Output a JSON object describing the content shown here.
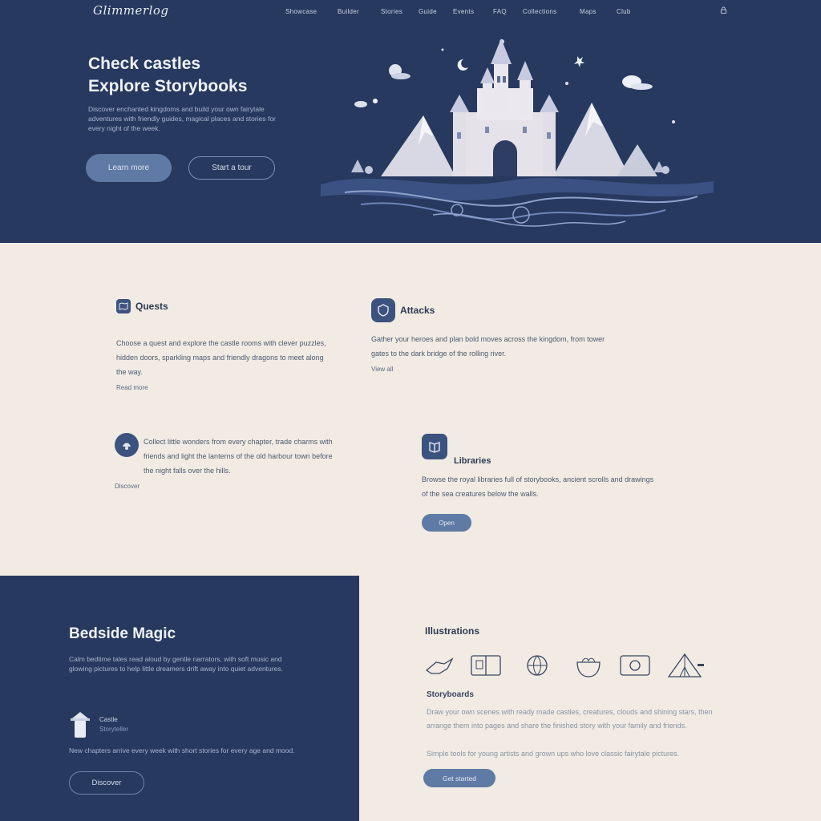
{
  "brand": {
    "logo_text": "Glimmerlog"
  },
  "nav": {
    "items": [
      "Showcase",
      "Builder",
      "Stories",
      "Guide",
      "Events",
      "FAQ",
      "Collections",
      "Maps",
      "Club"
    ]
  },
  "hero": {
    "title_line1": "Check castles",
    "title_line2": "Explore Storybooks",
    "text": "Discover enchanted kingdoms and build your own fairytale adventures with friendly guides, magical places and stories for every night of the week.",
    "primary_button": "Learn more",
    "secondary_button": "Start a tour"
  },
  "features": {
    "items": [
      {
        "title": "Quests",
        "text": "Choose a quest and explore the castle rooms with clever puzzles, hidden doors, sparkling maps and friendly dragons to meet along the way.",
        "link": "Read more"
      },
      {
        "title": "Attacks",
        "text": "Gather your heroes and plan bold moves across the kingdom, from tower gates to the dark bridge of the rolling river.",
        "link": "View all"
      },
      {
        "title": "",
        "text": "Collect little wonders from every chapter, trade charms with friends and light the lanterns of the old harbour town before the night falls over the hills.",
        "link": "Discover"
      },
      {
        "title": "Libraries",
        "text": "Browse the royal libraries full of storybooks, ancient scrolls and drawings of the sea creatures below the walls.",
        "button": "Open"
      }
    ]
  },
  "story": {
    "title": "Bedside Magic",
    "text": "Calm bedtime tales read aloud by gentle narrators, with soft music and glowing pictures to help little dreamers drift away into quiet adventures.",
    "author_name": "Castle",
    "author_role": "Storyteller",
    "text2": "New chapters arrive every week with short stories for every age and mood.",
    "button": "Discover"
  },
  "tools": {
    "title": "Illustrations",
    "icons": [
      "dragon-icon",
      "book-icon",
      "globe-icon",
      "cauldron-icon",
      "tv-icon",
      "tent-icon"
    ],
    "subtitle": "Storyboards",
    "text": "Draw your own scenes with ready made castles, creatures, clouds and shining stars, then arrange them into pages and share the finished story with your family and friends.",
    "text2": "Simple tools for young artists and grown ups who love classic fairytale pictures.",
    "button": "Get started"
  },
  "colors": {
    "navy": "#27395f",
    "cream": "#f1ebe3",
    "accent": "#5f7aa5"
  }
}
